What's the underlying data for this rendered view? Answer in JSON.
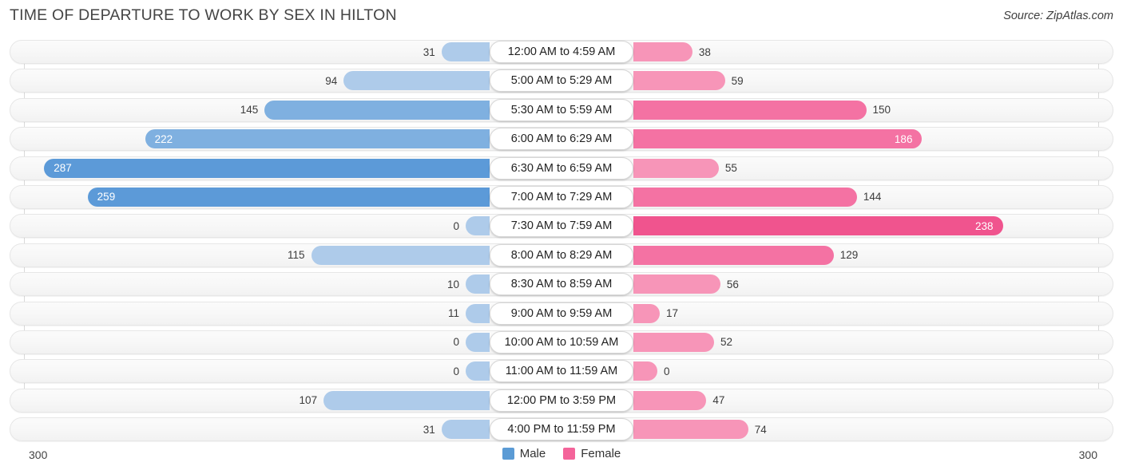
{
  "header": {
    "title": "TIME OF DEPARTURE TO WORK BY SEX IN HILTON",
    "source": "Source: ZipAtlas.com"
  },
  "axis": {
    "left_label": "300",
    "right_label": "300"
  },
  "legend": {
    "items": [
      {
        "label": "Male",
        "color": "#5b9bd5"
      },
      {
        "label": "Female",
        "color": "#f4649a"
      }
    ]
  },
  "colors": {
    "male_dark": "#5c9ad8",
    "male_mid": "#7fb0e0",
    "male_light": "#aecbea",
    "female_dark": "#f0548e",
    "female_mid": "#f472a3",
    "female_light": "#f795b8",
    "track": "#f6f6f6",
    "gridline": "#d9d9d9"
  },
  "chart_data": {
    "type": "bar",
    "subtype": "diverging-bidirectional",
    "title": "Time of Departure to Work by Sex in Hilton",
    "xlabel": "",
    "ylabel": "",
    "axis_max": 300,
    "xlim": [
      300,
      300
    ],
    "grid": true,
    "legend_position": "bottom-center",
    "categories": [
      "12:00 AM to 4:59 AM",
      "5:00 AM to 5:29 AM",
      "5:30 AM to 5:59 AM",
      "6:00 AM to 6:29 AM",
      "6:30 AM to 6:59 AM",
      "7:00 AM to 7:29 AM",
      "7:30 AM to 7:59 AM",
      "8:00 AM to 8:29 AM",
      "8:30 AM to 8:59 AM",
      "9:00 AM to 9:59 AM",
      "10:00 AM to 10:59 AM",
      "11:00 AM to 11:59 AM",
      "12:00 PM to 3:59 PM",
      "4:00 PM to 11:59 PM"
    ],
    "series": [
      {
        "name": "Male",
        "color": "#5b9bd5",
        "direction": "left",
        "values": [
          31,
          94,
          145,
          222,
          287,
          259,
          0,
          115,
          10,
          11,
          0,
          0,
          107,
          31
        ]
      },
      {
        "name": "Female",
        "color": "#f4649a",
        "direction": "right",
        "values": [
          38,
          59,
          150,
          186,
          55,
          144,
          238,
          129,
          56,
          17,
          52,
          0,
          47,
          74
        ]
      }
    ]
  }
}
